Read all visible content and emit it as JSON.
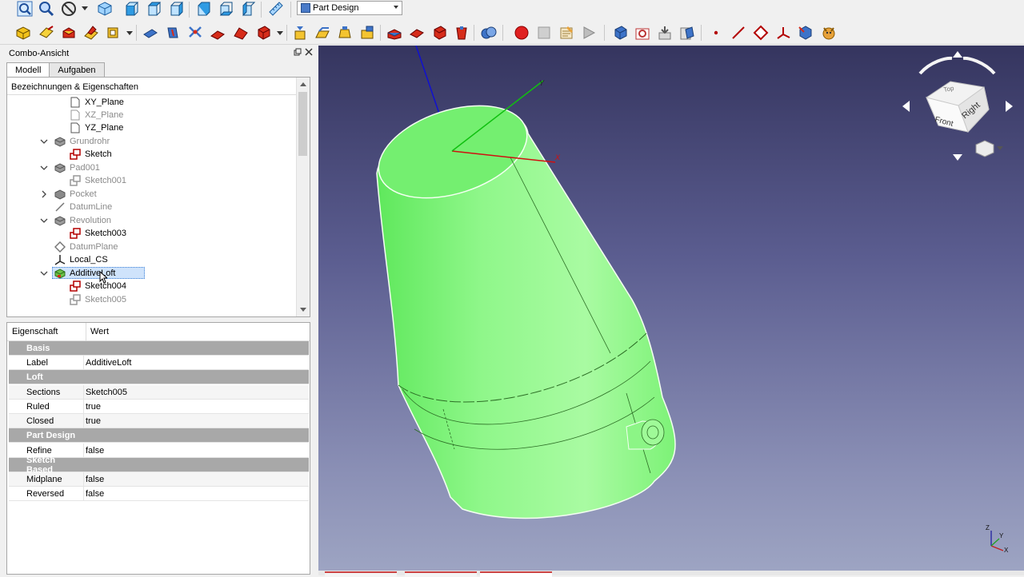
{
  "workbench": {
    "selected": "Part Design"
  },
  "combo": {
    "title": "Combo-Ansicht",
    "tabs": [
      {
        "label": "Modell"
      },
      {
        "label": "Aufgaben"
      }
    ]
  },
  "tree": {
    "header": "Bezeichnungen & Eigenschaften",
    "items": [
      {
        "label": "XY_Plane"
      },
      {
        "label": "XZ_Plane"
      },
      {
        "label": "YZ_Plane"
      },
      {
        "label": "Grundrohr"
      },
      {
        "label": "Sketch"
      },
      {
        "label": "Pad001"
      },
      {
        "label": "Sketch001"
      },
      {
        "label": "Pocket"
      },
      {
        "label": "DatumLine"
      },
      {
        "label": "Revolution"
      },
      {
        "label": "Sketch003"
      },
      {
        "label": "DatumPlane"
      },
      {
        "label": "Local_CS"
      },
      {
        "label": "AdditiveLoft"
      },
      {
        "label": "Sketch004"
      },
      {
        "label": "Sketch005"
      }
    ]
  },
  "properties": {
    "col_property": "Eigenschaft",
    "col_value": "Wert",
    "groups": {
      "basis": "Basis",
      "loft": "Loft",
      "part_design": "Part Design",
      "sketch_based": "Sketch Based"
    },
    "rows": {
      "label": {
        "k": "Label",
        "v": "AdditiveLoft"
      },
      "sections": {
        "k": "Sections",
        "v": "Sketch005"
      },
      "ruled": {
        "k": "Ruled",
        "v": "true"
      },
      "closed": {
        "k": "Closed",
        "v": "true"
      },
      "refine": {
        "k": "Refine",
        "v": "false"
      },
      "midplane": {
        "k": "Midplane",
        "v": "false"
      },
      "reversed": {
        "k": "Reversed",
        "v": "false"
      }
    }
  },
  "navcube": {
    "front": "Front",
    "right": "Right",
    "top": "Top"
  },
  "axis_labels": {
    "x": "X",
    "y": "Y",
    "z": "Z"
  },
  "colors": {
    "solid": "#7ef57a",
    "record": "#e02020",
    "view_bg_top": "#35355f",
    "view_bg_bottom": "#9ea5c3",
    "selection": "#cfe3fb"
  }
}
